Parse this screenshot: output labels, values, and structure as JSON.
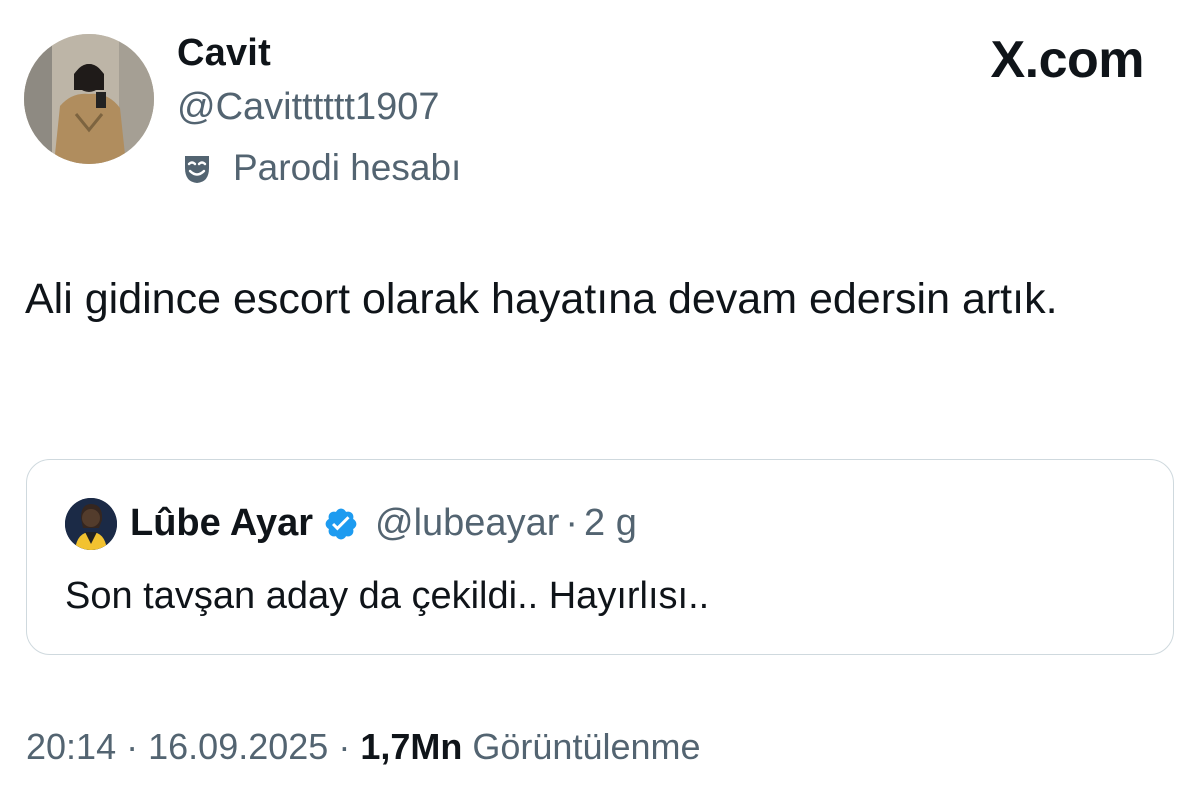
{
  "author": {
    "display_name": "Cavit",
    "handle": "@Cavitttttt1907",
    "parody_label": "Parodi hesabı",
    "avatar_icon": "profile-photo"
  },
  "brand": {
    "label": "X.com"
  },
  "tweet": {
    "text": "Ali gidince escort olarak hayatına devam edersin artık."
  },
  "quoted_tweet": {
    "display_name": "Lûbe Ayar",
    "verified_icon": "verified-badge-icon",
    "handle": "@lubeayar",
    "separator": "·",
    "time": "2 g",
    "text": "Son tavşan aday da çekildi.. Hayırlısı.."
  },
  "meta": {
    "time": "20:14",
    "separator": "·",
    "date": "16.09.2025",
    "views_count": "1,7Mn",
    "views_label": "Görüntülenme"
  },
  "colors": {
    "secondary_text": "#536471",
    "primary_text": "#0f1419",
    "verified_blue": "#1d9bf0",
    "card_border": "#cfd9de"
  }
}
